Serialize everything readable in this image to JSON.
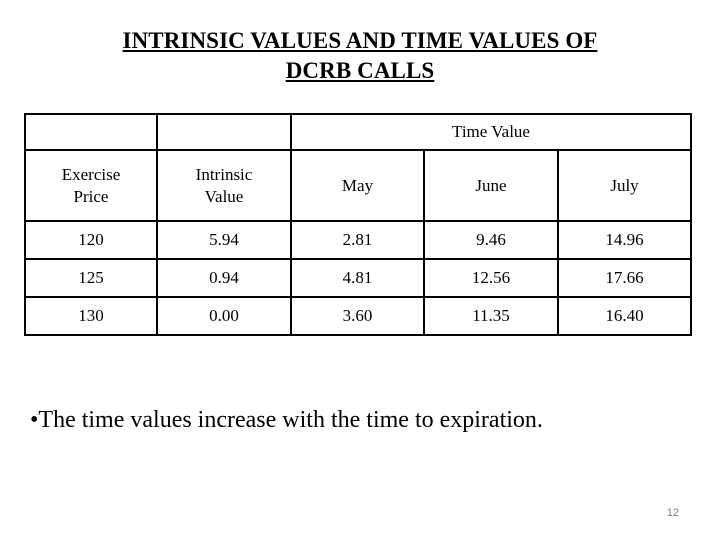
{
  "slide": {
    "title_lines": [
      "INTRINSIC VALUES AND TIME VALUES OF",
      "DCRB CALLS"
    ],
    "page_number": "12",
    "bullet_text": "•The time values increase with the time to expiration.",
    "text_color": "#000000",
    "page_number_color": "#808080",
    "background_color": "#ffffff",
    "border_color": "#000000"
  },
  "table": {
    "group_header": {
      "blank_1": "",
      "blank_2": "",
      "time_value_label": "Time Value"
    },
    "columns": [
      "Exercise Price",
      "Intrinsic Value",
      "May",
      "June",
      "July"
    ],
    "column_labels": {
      "exercise_price_line1": "Exercise",
      "exercise_price_line2": "Price",
      "intrinsic_value_line1": "Intrinsic",
      "intrinsic_value_line2": "Value",
      "may": "May",
      "june": "June",
      "july": "July"
    },
    "rows": [
      {
        "exercise_price": "120",
        "intrinsic_value": "5.94",
        "may": "2.81",
        "june": "9.46",
        "july": "14.96"
      },
      {
        "exercise_price": "125",
        "intrinsic_value": "0.94",
        "may": "4.81",
        "june": "12.56",
        "july": "17.66"
      },
      {
        "exercise_price": "130",
        "intrinsic_value": "0.00",
        "may": "3.60",
        "june": "11.35",
        "july": "16.40"
      }
    ]
  }
}
